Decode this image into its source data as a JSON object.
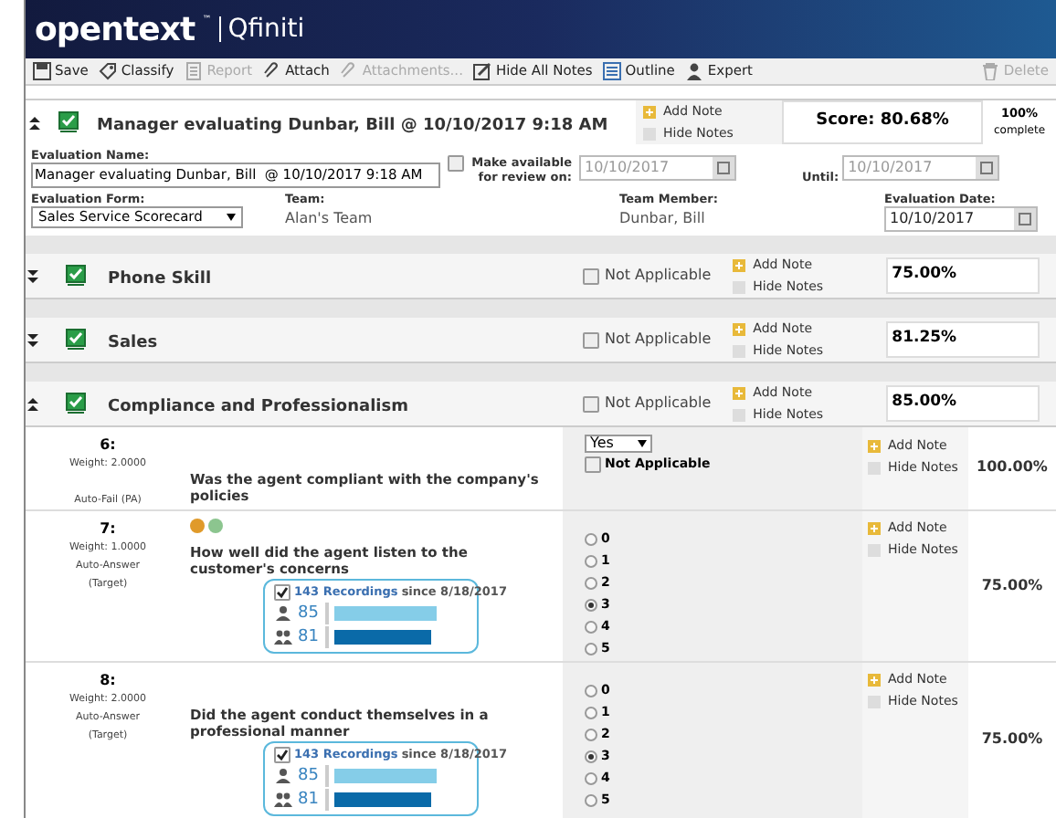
{
  "header": {
    "brand": "opentext",
    "trademark": "™",
    "product": "Qfiniti"
  },
  "toolbar": [
    {
      "label": "Save",
      "kind": "save",
      "disabled": false
    },
    {
      "label": "Classify",
      "kind": "tag",
      "disabled": false
    },
    {
      "label": "Report",
      "kind": "report",
      "disabled": true
    },
    {
      "label": "Attach",
      "kind": "clip",
      "disabled": false
    },
    {
      "label": "Attachments...",
      "kind": "clip",
      "disabled": true
    },
    {
      "label": "Hide All Notes",
      "kind": "note",
      "disabled": false
    },
    {
      "label": "Outline",
      "kind": "list",
      "disabled": false
    },
    {
      "label": "Expert",
      "kind": "user",
      "disabled": false
    },
    {
      "label": "Delete",
      "kind": "trash",
      "disabled": true
    }
  ],
  "evaluation": {
    "title": "Manager evaluating Dunbar, Bill @ 10/10/2017 9:18 AM",
    "expanded": true,
    "add_note": "Add Note",
    "hide_notes": "Hide Notes",
    "score": "Score: 80.68%",
    "complete": "100%",
    "complete_label": "complete"
  },
  "fields": {
    "evaluation_name": {
      "label": "Evaluation Name:",
      "value": "Manager evaluating Dunbar, Bill  @ 10/10/2017 9:18 AM"
    },
    "make_available": {
      "label": "Make available for review on:",
      "checked": false,
      "value": "10/10/2017"
    },
    "until": {
      "label": "Until:",
      "value": "10/10/2017"
    },
    "evaluation_form": {
      "label": "Evaluation Form:",
      "value": "Sales Service Scorecard"
    },
    "team": {
      "label": "Team:",
      "value": "Alan's Team"
    },
    "team_member": {
      "label": "Team Member:",
      "value": "Dunbar, Bill"
    },
    "evaluation_date": {
      "label": "Evaluation Date:",
      "value": "10/10/2017"
    }
  },
  "sections": [
    {
      "name": "Phone Skill",
      "expanded": false,
      "not_applicable": {
        "label": "Not Applicable",
        "checked": false
      },
      "add_note": "Add Note",
      "hide_notes": "Hide Notes",
      "score": "75.00%"
    },
    {
      "name": "Sales",
      "expanded": false,
      "not_applicable": {
        "label": "Not Applicable",
        "checked": false
      },
      "add_note": "Add Note",
      "hide_notes": "Hide Notes",
      "score": "81.25%"
    },
    {
      "name": "Compliance and Professionalism",
      "expanded": true,
      "not_applicable": {
        "label": "Not Applicable",
        "checked": false
      },
      "add_note": "Add Note",
      "hide_notes": "Hide Notes",
      "score": "85.00%"
    }
  ],
  "questions": [
    {
      "number": "6:",
      "weight": "Weight: 2.0000",
      "mode": [
        "Auto-Fail (PA)"
      ],
      "badges": false,
      "text": "Was the agent compliant with the company's policies",
      "kind": "select",
      "answer": "Yes",
      "not_applicable": {
        "label": "Not Applicable",
        "checked": false
      },
      "add_note": "Add Note",
      "hide_notes": "Hide Notes",
      "score": "100.00%"
    },
    {
      "number": "7:",
      "weight": "Weight: 1.0000",
      "mode": [
        "Auto-Answer",
        "(Target)"
      ],
      "badges": true,
      "text": "How well did the agent listen to the customer's concerns",
      "kind": "radio",
      "options": [
        {
          "label": "0",
          "selected": false
        },
        {
          "label": "1",
          "selected": false
        },
        {
          "label": "2",
          "selected": false
        },
        {
          "label": "3",
          "selected": true
        },
        {
          "label": "4",
          "selected": false
        },
        {
          "label": "5",
          "selected": false
        }
      ],
      "recordings": {
        "checked": true,
        "link": "143 Recordings",
        "since": "since 8/18/2017",
        "agent": "85",
        "team": "81"
      },
      "add_note": "Add Note",
      "hide_notes": "Hide Notes",
      "score": "75.00%"
    },
    {
      "number": "8:",
      "weight": "Weight: 2.0000",
      "mode": [
        "Auto-Answer",
        "(Target)"
      ],
      "badges": false,
      "text": "Did the agent conduct themselves in a professional manner",
      "kind": "radio",
      "options": [
        {
          "label": "0",
          "selected": false
        },
        {
          "label": "1",
          "selected": false
        },
        {
          "label": "2",
          "selected": false
        },
        {
          "label": "3",
          "selected": true
        },
        {
          "label": "4",
          "selected": false
        },
        {
          "label": "5",
          "selected": false
        }
      ],
      "recordings": {
        "checked": true,
        "link": "143 Recordings",
        "since": "since 8/18/2017",
        "agent": "85",
        "team": "81"
      },
      "add_note": "Add Note",
      "hide_notes": "Hide Notes",
      "score": "75.00%"
    }
  ]
}
